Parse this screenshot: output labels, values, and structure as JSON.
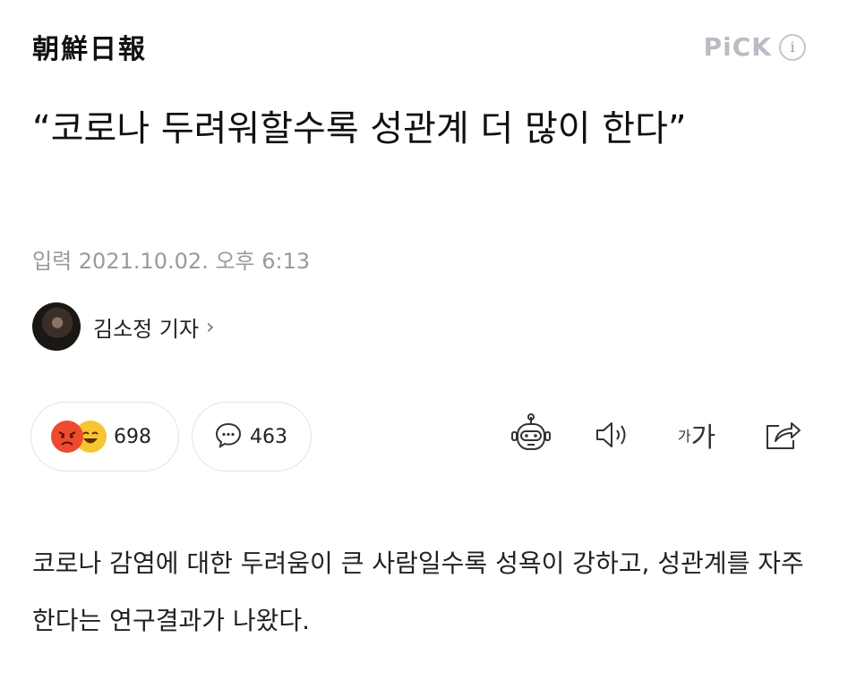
{
  "header": {
    "press_name": "朝鮮日報",
    "pick_label": "PiCK",
    "info_glyph": "i"
  },
  "article": {
    "headline": "“코로나 두려워할수록 성관계 더 많이 한다”",
    "dateline": "입력 2021.10.02. 오후 6:13",
    "reporter": "김소정 기자",
    "reporter_chevron": "›",
    "body": "코로나 감염에 대한 두려움이 큰 사람일수록 성욕이 강하고, 성관계를 자주 한다는 연구결과가 나왔다."
  },
  "reactions": {
    "reaction_count": "698",
    "comment_count": "463",
    "emojis": [
      "angry-face",
      "laughing-face"
    ]
  },
  "toolbar": {
    "font_size_small": "가",
    "font_size_large": "가",
    "icons": [
      "robot-summary-icon",
      "speaker-icon",
      "font-size-icon",
      "share-icon"
    ]
  },
  "colors": {
    "pick": "#b9bdc3",
    "date": "#9a9a9a",
    "angry": "#ee4a30",
    "laugh": "#f7c531"
  }
}
